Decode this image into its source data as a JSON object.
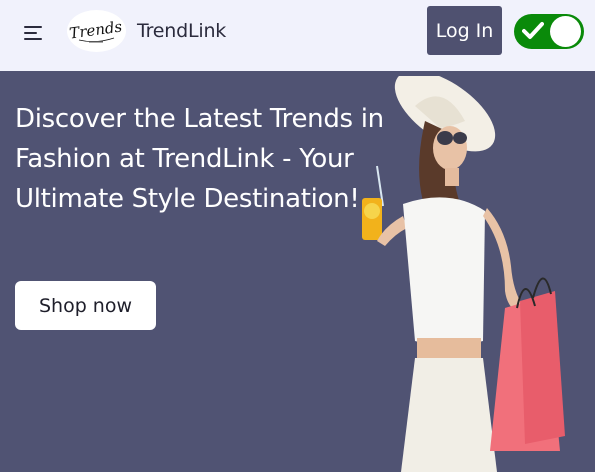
{
  "header": {
    "brand": "TrendLink",
    "logo_text": "Trends",
    "login_label": "Log In",
    "toggle_on": true
  },
  "hero": {
    "title": "Discover the Latest Trends in Fashion at TrendLink - Your Ultimate Style Destination!",
    "cta_label": "Shop now"
  },
  "colors": {
    "nav_bg": "#f1f2fc",
    "hero_bg": "#505373",
    "login_bg": "#4f5170",
    "toggle_on": "#0a8a0a"
  },
  "icons": {
    "menu": "menu-icon",
    "toggle": "check-icon"
  }
}
